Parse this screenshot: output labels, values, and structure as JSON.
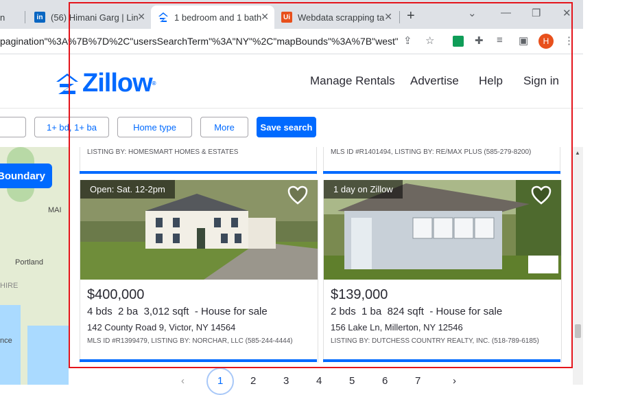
{
  "browser": {
    "tabs": [
      {
        "title": "n",
        "favicon": "partial-tab"
      },
      {
        "title": "(56) Himani Garg | Lin",
        "favicon": "linkedin-icon"
      },
      {
        "title": "1 bedroom and 1 bath",
        "favicon": "zillow-icon",
        "active": true
      },
      {
        "title": "Webdata scrapping ta",
        "favicon": "upwork-icon"
      }
    ],
    "url": "pagination\"%3A%7B%7D%2C\"usersSearchTerm\"%3A\"NY\"%2C\"mapBounds\"%3A%7B\"west\"...",
    "avatar_letter": "H",
    "colors": {
      "avatar": "#e8501c",
      "accent": "#006aff"
    }
  },
  "header": {
    "logo_text": "Zillow",
    "nav": [
      "Manage Rentals",
      "Advertise",
      "Help",
      "Sign in"
    ]
  },
  "filters": {
    "beds_baths": "1+ bd, 1+ ba",
    "home_type": "Home type",
    "more": "More",
    "save_search": "Save search"
  },
  "map": {
    "boundary_button": "Boundary",
    "labels": [
      "MAI",
      "Portland",
      "HIRE",
      "nce"
    ]
  },
  "listings_top": [
    {
      "meta": "LISTING BY: HOMESMART HOMES & ESTATES"
    },
    {
      "meta": "MLS ID #R1401494, LISTING BY: RE/MAX PLUS (585-279-8200)"
    }
  ],
  "listings": [
    {
      "badge": "Open: Sat. 12-2pm",
      "price": "$400,000",
      "beds": "4 bds",
      "baths": "2 ba",
      "sqft": "3,012 sqft",
      "type": "- House for sale",
      "address": "142 County Road 9, Victor, NY 14564",
      "mls": "MLS ID #R1399479, LISTING BY: NORCHAR, LLC (585-244-4444)"
    },
    {
      "badge": "1 day on Zillow",
      "price": "$139,000",
      "beds": "2 bds",
      "baths": "1 ba",
      "sqft": "824 sqft",
      "type": "- House for sale",
      "address": "156 Lake Ln, Millerton, NY 12546",
      "mls": "LISTING BY: DUTCHESS COUNTRY REALTY, INC. (518-789-6185)"
    }
  ],
  "pagination": {
    "prev": "‹",
    "pages": [
      "1",
      "2",
      "3",
      "4",
      "5",
      "6",
      "7"
    ],
    "next": "›",
    "current": "1"
  }
}
